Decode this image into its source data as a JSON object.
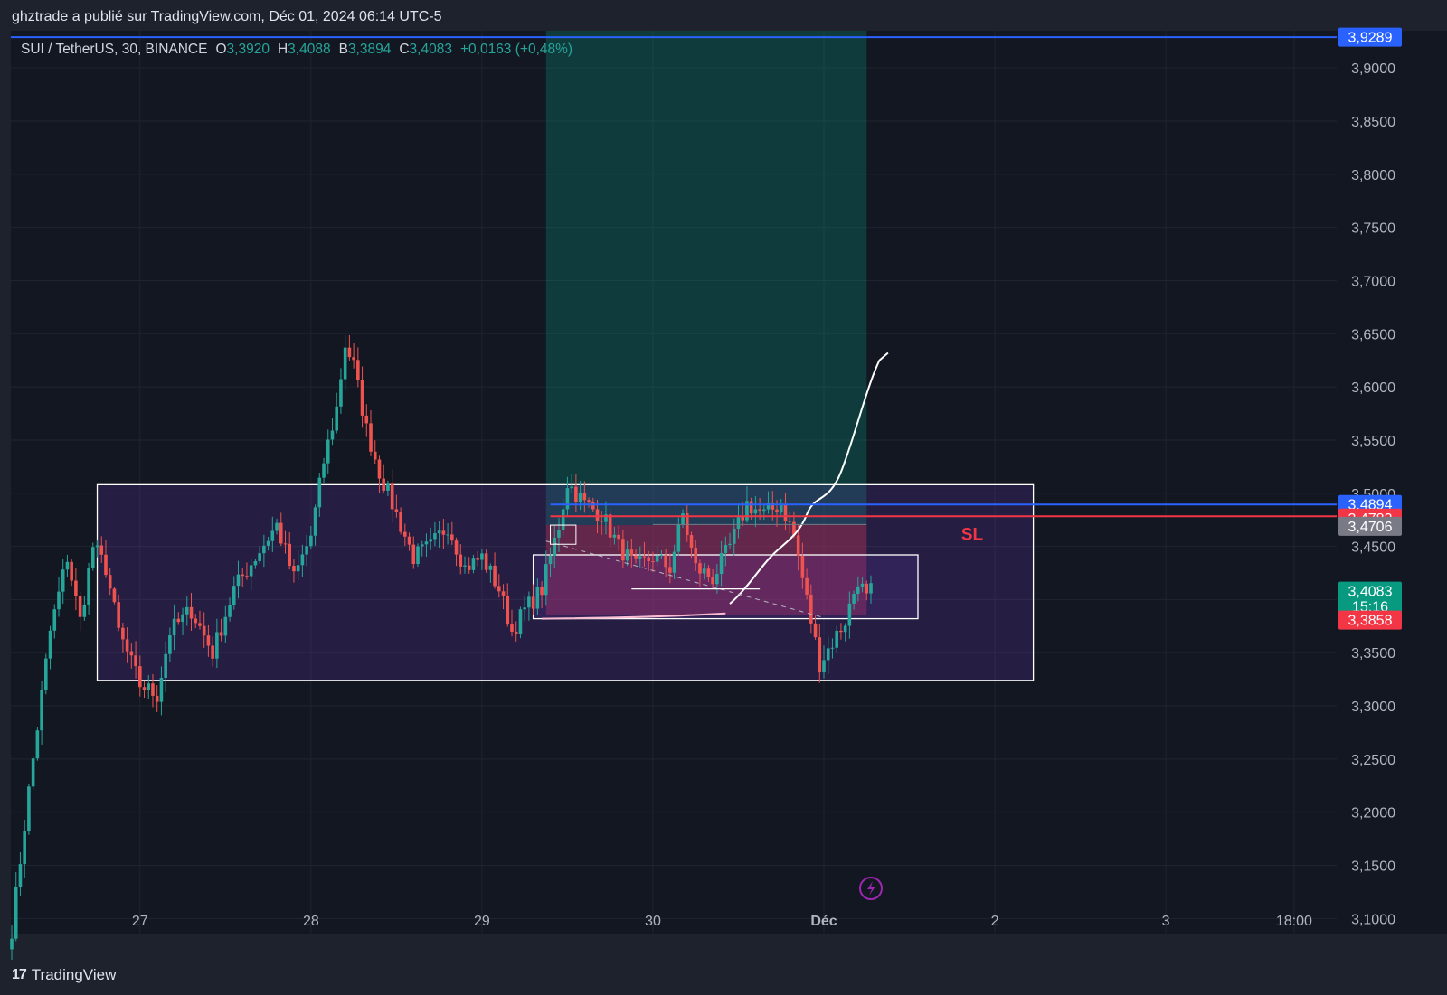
{
  "publisher_line": "ghztrade a publié sur TradingView.com, Déc 01, 2024 06:14 UTC-5",
  "legend": {
    "symbol": "SUI / TetherUS, 30, BINANCE",
    "open_key": "O",
    "open": "3,3920",
    "high_key": "H",
    "high": "3,4088",
    "low_key": "B",
    "low": "3,3894",
    "close_key": "C",
    "close": "3,4083",
    "change": "+0,0163 (+0,48%)"
  },
  "brand": {
    "logo": "17",
    "name": "TradingView"
  },
  "colors": {
    "background": "#131722",
    "frame": "#1e222d",
    "up": "#26a69a",
    "down": "#ef5350",
    "line_blue": "#2962ff",
    "line_red": "#f23645",
    "zone": "#673ab7",
    "target_zone": "#089981"
  },
  "chart_data": {
    "type": "candlestick",
    "y_axis_ticks": [
      "3,9000",
      "3,8500",
      "3,8000",
      "3,7500",
      "3,7000",
      "3,6500",
      "3,6000",
      "3,5500",
      "3,5000",
      "3,4500",
      "3,4000",
      "3,3500",
      "3,3000",
      "3,2500",
      "3,2000",
      "3,1500",
      "3,1000"
    ],
    "x_axis_ticks": [
      "27",
      "28",
      "29",
      "30",
      "Déc",
      "2",
      "3",
      "18:00"
    ],
    "ylim": [
      3.085,
      3.935
    ],
    "price_labels": [
      {
        "value": "3,9289",
        "color": "#2962ff"
      },
      {
        "value": "3,4894",
        "color": "#2962ff"
      },
      {
        "value": "3,4783",
        "color": "#f23645"
      },
      {
        "value": "3,4706",
        "color": "#787b86"
      },
      {
        "value": "3,4083",
        "sub": "15:16",
        "color": "#089981"
      },
      {
        "value": "3,3858",
        "color": "#f23645"
      }
    ],
    "horizontal_lines": [
      {
        "price": 3.9289,
        "color": "#2962ff"
      },
      {
        "price": 3.4894,
        "color": "#2962ff"
      },
      {
        "price": 3.4783,
        "color": "#f23645"
      }
    ],
    "annotations": [
      {
        "text": "SL",
        "color": "#f23645"
      }
    ],
    "anchors": [
      {
        "day": "26",
        "t": 0,
        "price": 3.09
      },
      {
        "day": "26",
        "t": 4,
        "price": 3.22
      },
      {
        "day": "26",
        "t": 9,
        "price": 3.37
      },
      {
        "day": "26",
        "t": 13,
        "price": 3.44
      },
      {
        "day": "26",
        "t": 16,
        "price": 3.38
      },
      {
        "day": "26",
        "t": 19,
        "price": 3.45
      },
      {
        "day": "26",
        "t": 22,
        "price": 3.43
      },
      {
        "day": "26",
        "t": 25,
        "price": 3.37
      },
      {
        "day": "26",
        "t": 30,
        "price": 3.32
      },
      {
        "day": "27",
        "t": 34,
        "price": 3.31
      },
      {
        "day": "27",
        "t": 37,
        "price": 3.37
      },
      {
        "day": "27",
        "t": 42,
        "price": 3.39
      },
      {
        "day": "27",
        "t": 47,
        "price": 3.35
      },
      {
        "day": "27",
        "t": 52,
        "price": 3.41
      },
      {
        "day": "27",
        "t": 57,
        "price": 3.44
      },
      {
        "day": "27",
        "t": 62,
        "price": 3.47
      },
      {
        "day": "27",
        "t": 66,
        "price": 3.42
      },
      {
        "day": "27",
        "t": 70,
        "price": 3.46
      },
      {
        "day": "28",
        "t": 73,
        "price": 3.53
      },
      {
        "day": "28",
        "t": 76,
        "price": 3.58
      },
      {
        "day": "28",
        "t": 78,
        "price": 3.64
      },
      {
        "day": "28",
        "t": 80,
        "price": 3.62
      },
      {
        "day": "28",
        "t": 83,
        "price": 3.56
      },
      {
        "day": "28",
        "t": 86,
        "price": 3.52
      },
      {
        "day": "28",
        "t": 90,
        "price": 3.48
      },
      {
        "day": "28",
        "t": 94,
        "price": 3.44
      },
      {
        "day": "28",
        "t": 98,
        "price": 3.45
      },
      {
        "day": "28",
        "t": 102,
        "price": 3.47
      },
      {
        "day": "28",
        "t": 106,
        "price": 3.43
      },
      {
        "day": "28",
        "t": 110,
        "price": 3.44
      },
      {
        "day": "29",
        "t": 114,
        "price": 3.41
      },
      {
        "day": "29",
        "t": 117,
        "price": 3.37
      },
      {
        "day": "29",
        "t": 120,
        "price": 3.39
      },
      {
        "day": "29",
        "t": 124,
        "price": 3.41
      },
      {
        "day": "29",
        "t": 128,
        "price": 3.47
      },
      {
        "day": "29",
        "t": 130,
        "price": 3.51
      },
      {
        "day": "29",
        "t": 134,
        "price": 3.49
      },
      {
        "day": "29",
        "t": 138,
        "price": 3.48
      },
      {
        "day": "29",
        "t": 142,
        "price": 3.45
      },
      {
        "day": "29",
        "t": 146,
        "price": 3.43
      },
      {
        "day": "30",
        "t": 150,
        "price": 3.44
      },
      {
        "day": "30",
        "t": 154,
        "price": 3.43
      },
      {
        "day": "30",
        "t": 157,
        "price": 3.48
      },
      {
        "day": "30",
        "t": 160,
        "price": 3.43
      },
      {
        "day": "30",
        "t": 164,
        "price": 3.42
      },
      {
        "day": "30",
        "t": 168,
        "price": 3.45
      },
      {
        "day": "30",
        "t": 172,
        "price": 3.49
      },
      {
        "day": "30",
        "t": 176,
        "price": 3.48
      },
      {
        "day": "30",
        "t": 180,
        "price": 3.49
      },
      {
        "day": "30",
        "t": 183,
        "price": 3.46
      },
      {
        "day": "30",
        "t": 186,
        "price": 3.4
      },
      {
        "day": "01",
        "t": 189,
        "price": 3.34
      },
      {
        "day": "01",
        "t": 192,
        "price": 3.36
      },
      {
        "day": "01",
        "t": 195,
        "price": 3.38
      },
      {
        "day": "01",
        "t": 198,
        "price": 3.42
      },
      {
        "day": "01",
        "t": 200,
        "price": 3.4
      },
      {
        "day": "01",
        "t": 201,
        "price": 3.408
      }
    ]
  }
}
